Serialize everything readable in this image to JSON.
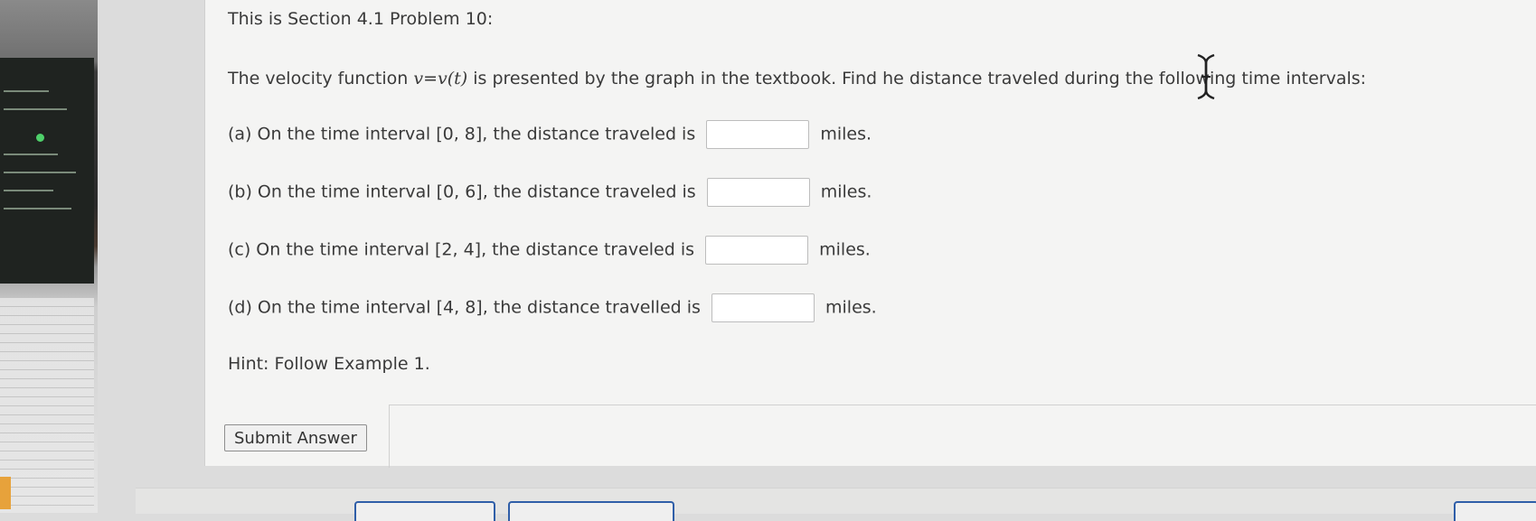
{
  "problem": {
    "title": "This is Section 4.1 Problem 10:",
    "intro_before_math": "The velocity function",
    "math_expr": "v=v(t)",
    "intro_after_math": "is presented by the graph in the textbook. Find he distance traveled during the following time intervals:",
    "parts": [
      {
        "prefix": "(a) On the time interval [0, 8], the distance traveled is",
        "value": "",
        "unit": "miles."
      },
      {
        "prefix": "(b) On the time interval [0, 6], the distance traveled is",
        "value": "",
        "unit": "miles."
      },
      {
        "prefix": "(c) On the time interval [2, 4], the distance traveled is",
        "value": "",
        "unit": "miles."
      },
      {
        "prefix": "(d) On the time interval [4, 8], the distance travelled is",
        "value": "",
        "unit": "miles."
      }
    ],
    "hint": "Hint: Follow Example 1.",
    "submit_label": "Submit Answer"
  },
  "cursor": {
    "icon": "text-cursor-icon"
  },
  "colors": {
    "card_bg": "#f4f4f3",
    "tab_border": "#2f5ea8",
    "background": "#dcdcdc"
  }
}
